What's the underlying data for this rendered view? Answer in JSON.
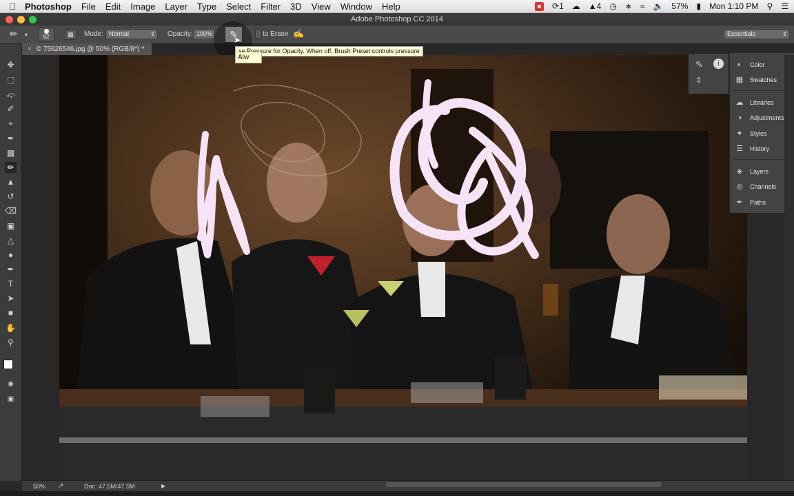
{
  "menubar": {
    "app_name": "Photoshop",
    "items": [
      "File",
      "Edit",
      "Image",
      "Layer",
      "Type",
      "Select",
      "Filter",
      "3D",
      "View",
      "Window",
      "Help"
    ],
    "status_1": "1",
    "status_4": "4",
    "battery": "57%",
    "clock": "Mon 1:10 PM"
  },
  "window": {
    "title": "Adobe Photoshop CC 2014"
  },
  "options_bar": {
    "brush_size": "62",
    "mode_label": "Mode:",
    "mode_value": "Normal",
    "opacity_label": "Opacity:",
    "opacity_value": "100%",
    "auto_erase_label": "to Erase",
    "workspace_value": "Essentials"
  },
  "tooltip": {
    "text": "se Pressure for Opacity. When off, Brush Preset controls pressure",
    "short": "Alw"
  },
  "document": {
    "tab_title": "© 75626546.jpg @ 50% (RGB/8*) *"
  },
  "panels": {
    "items": [
      "Color",
      "Swatches",
      "Libraries",
      "Adjustments",
      "Styles",
      "History",
      "Layers",
      "Channels",
      "Paths"
    ]
  },
  "status_bar": {
    "zoom": "50%",
    "doc_size": "Doc: 47.5M/47.5M"
  },
  "colors": {
    "foreground": "#ffffff",
    "background": "#e0207a",
    "stroke": "#f6e3f6"
  }
}
